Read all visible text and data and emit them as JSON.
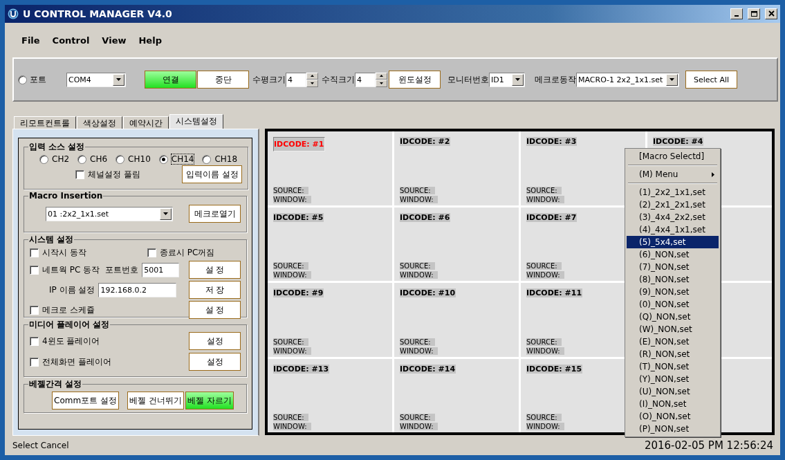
{
  "window": {
    "title": "U CONTROL MANAGER V4.0"
  },
  "menu_bar": [
    "File",
    "Control",
    "View",
    "Help"
  ],
  "toolbar": {
    "port_radio": {
      "label": "포트",
      "selected": false
    },
    "port_select": "COM4",
    "buttons": [
      {
        "label": "연결",
        "active": true
      },
      {
        "label": "중단",
        "active": false
      }
    ],
    "h_size": {
      "label": "수평크기",
      "value": "4"
    },
    "v_size": {
      "label": "수직크기",
      "value": "4"
    },
    "window_button": "윈도설정",
    "monitor": {
      "label": "모니터번호",
      "value": "ID1"
    },
    "macro": {
      "label": "메크로동작",
      "value": "MACRO-1  2x2_1x1.set"
    },
    "select_all_button": "Select All"
  },
  "tabs": [
    {
      "label": "리모트컨트롤",
      "selected": false
    },
    {
      "label": "색상설정",
      "selected": false
    },
    {
      "label": "예약시간",
      "selected": false
    },
    {
      "label": "시스템설정",
      "selected": true
    }
  ],
  "input_source": {
    "title": "입력 소스 설정",
    "channels": [
      {
        "label": "CH2",
        "selected": false
      },
      {
        "label": "CH6",
        "selected": false
      },
      {
        "label": "CH10",
        "selected": false
      },
      {
        "label": "CH14",
        "selected": true
      },
      {
        "label": "CH18",
        "selected": false
      }
    ],
    "unlock": {
      "label": "체널설정 풀림",
      "checked": false
    },
    "button": "입력이름 설정"
  },
  "macro_insertion": {
    "title": "Macro Insertion",
    "select": "01 :2x2_1x1.set",
    "button": "메크로열기"
  },
  "system": {
    "title": "시스템 설정",
    "start": {
      "label": "시작시 동작",
      "checked": false
    },
    "pc_off": {
      "label": "종료시 PC꺼짐",
      "checked": false
    },
    "network": {
      "label": "네트웍 PC 동작",
      "checked": false
    },
    "port_label": "포트번호",
    "port": "5001",
    "set_button": "설 정",
    "ip_label": "IP 이름 설정",
    "ip": "192.168.0.2",
    "save_button": "저 장",
    "schedule": {
      "label": "메크로 스케쥴",
      "checked": false
    },
    "schedule_button": "설 정"
  },
  "media": {
    "title": "미디어 플레이어 설정",
    "rows": [
      {
        "label": "4윈도 플레이어",
        "checked": false,
        "button": "설정"
      },
      {
        "label": "전체화면 플레이어",
        "checked": false,
        "button": "설정"
      }
    ]
  },
  "bezel": {
    "title": "베젤간격 설정",
    "buttons": [
      {
        "label": "Comm포트 설정",
        "active": false
      },
      {
        "label": "베젤 건너뛰기",
        "active": false
      },
      {
        "label": "베젤 자르기",
        "active": true
      }
    ]
  },
  "grid": {
    "cells": [
      {
        "kind": "device",
        "idcode": "IDCODE: #1",
        "selected": true,
        "source": "SOURCE:",
        "window": "WINDOW:"
      },
      {
        "kind": "device",
        "idcode": "IDCODE: #2",
        "selected": false,
        "source": "SOURCE:",
        "window": "WINDOW:"
      },
      {
        "kind": "device",
        "idcode": "IDCODE: #3",
        "selected": false,
        "source": "SOURCE:",
        "window": "WINDOW:"
      },
      {
        "kind": "device",
        "idcode": "IDCODE: #4",
        "selected": false
      },
      {
        "kind": "device",
        "idcode": "IDCODE: #5",
        "selected": false,
        "source": "SOURCE:",
        "window": "WINDOW:"
      },
      {
        "kind": "device",
        "idcode": "IDCODE: #6",
        "selected": false,
        "source": "SOURCE:",
        "window": "WINDOW:"
      },
      {
        "kind": "device",
        "idcode": "IDCODE: #7",
        "selected": false,
        "source": "SOURCE:",
        "window": "WINDOW:"
      },
      {
        "kind": "covered"
      },
      {
        "kind": "device",
        "idcode": "IDCODE: #9",
        "selected": false,
        "source": "SOURCE:",
        "window": "WINDOW:"
      },
      {
        "kind": "device",
        "idcode": "IDCODE: #10",
        "selected": false,
        "source": "SOURCE:",
        "window": "WINDOW:"
      },
      {
        "kind": "device",
        "idcode": "IDCODE: #11",
        "selected": false,
        "source": "SOURCE:",
        "window": "WINDOW:"
      },
      {
        "kind": "covered"
      },
      {
        "kind": "device",
        "idcode": "IDCODE: #13",
        "selected": false,
        "source": "SOURCE:",
        "window": "WINDOW:"
      },
      {
        "kind": "device",
        "idcode": "IDCODE: #14",
        "selected": false,
        "source": "SOURCE:",
        "window": "WINDOW:"
      },
      {
        "kind": "device",
        "idcode": "IDCODE: #15",
        "selected": false,
        "source": "SOURCE:",
        "window": "WINDOW:"
      },
      {
        "kind": "covered"
      }
    ]
  },
  "popup_menu": {
    "header": "[Macro Selectd]",
    "submenu": "(M) Menu",
    "items": [
      {
        "label": "(1)_2x2_1x1,set",
        "selected": false
      },
      {
        "label": "(2)_2x1_2x1,set",
        "selected": false
      },
      {
        "label": "(3)_4x4_2x2,set",
        "selected": false
      },
      {
        "label": "(4)_4x4_1x1,set",
        "selected": false
      },
      {
        "label": "(5)_5x4,set",
        "selected": true
      },
      {
        "label": "(6)_NON,set",
        "selected": false
      },
      {
        "label": "(7)_NON,set",
        "selected": false
      },
      {
        "label": "(8)_NON,set",
        "selected": false
      },
      {
        "label": "(9)_NON,set",
        "selected": false
      },
      {
        "label": "(0)_NON,set",
        "selected": false
      },
      {
        "label": "(Q)_NON,set",
        "selected": false
      },
      {
        "label": "(W)_NON,set",
        "selected": false
      },
      {
        "label": "(E)_NON,set",
        "selected": false
      },
      {
        "label": "(R)_NON,set",
        "selected": false
      },
      {
        "label": "(T)_NON,set",
        "selected": false
      },
      {
        "label": "(Y)_NON,set",
        "selected": false
      },
      {
        "label": "(U)_NON,set",
        "selected": false
      },
      {
        "label": "(I)_NON,set",
        "selected": false
      },
      {
        "label": "(O)_NON,set",
        "selected": false
      },
      {
        "label": "(P)_NON,set",
        "selected": false
      }
    ]
  },
  "status_bar": {
    "message": "Select Cancel",
    "datetime": "2016-02-05 PM 12:56:24"
  }
}
